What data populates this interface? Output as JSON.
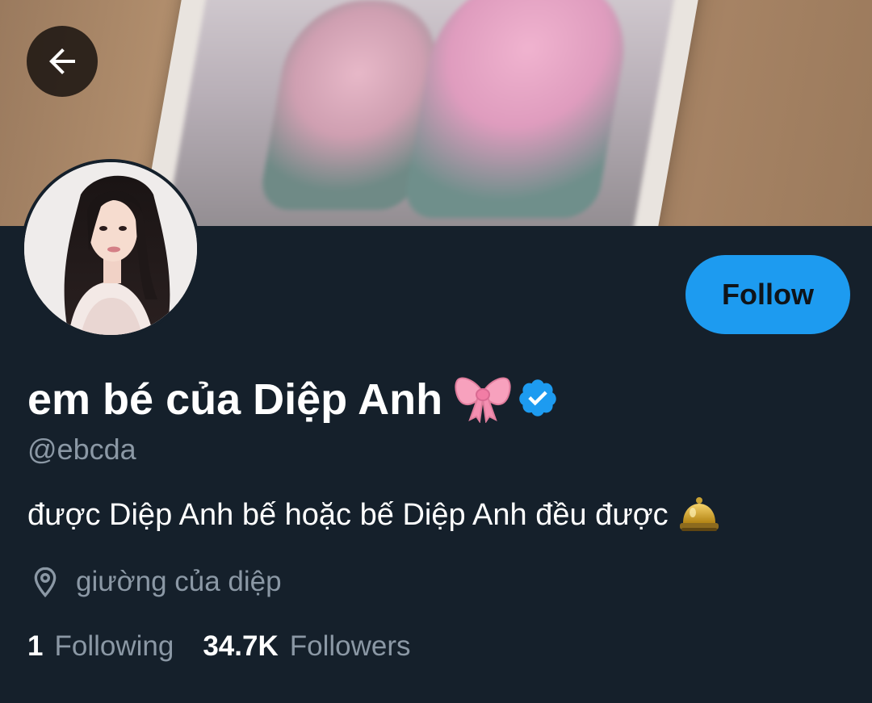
{
  "header": {
    "back_icon": "arrow-left-icon"
  },
  "profile": {
    "display_name": "em bé của Diệp Anh",
    "name_emoji": "ribbon-bow-icon",
    "verified_icon": "verified-badge-icon",
    "handle": "@ebcda",
    "bio": "được Diệp Anh bế hoặc bế Diệp Anh đều được",
    "bio_emoji": "bell-icon",
    "location_icon": "location-pin-icon",
    "location": "giường của diệp",
    "follow_label": "Follow"
  },
  "stats": {
    "following_count": "1",
    "following_label": "Following",
    "followers_count": "34.7K",
    "followers_label": "Followers"
  },
  "colors": {
    "background": "#15202b",
    "accent": "#1d9bf0",
    "secondary_text": "#8b98a5",
    "primary_text": "#ffffff"
  }
}
